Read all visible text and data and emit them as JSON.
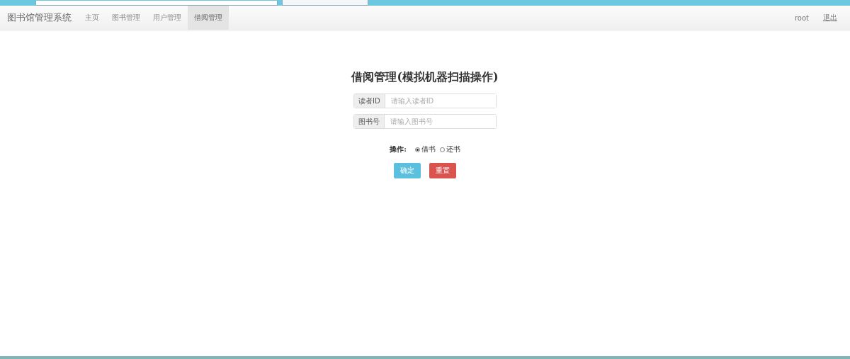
{
  "navbar": {
    "brand": "图书馆管理系统",
    "items": [
      {
        "label": "主页",
        "selected": false
      },
      {
        "label": "图书管理",
        "selected": false
      },
      {
        "label": "用户管理",
        "selected": false
      },
      {
        "label": "借阅管理",
        "selected": true
      }
    ],
    "user": "root",
    "logout": "退出"
  },
  "form": {
    "title": "借阅管理(模拟机器扫描操作)",
    "fields": [
      {
        "label": "读者ID",
        "placeholder": "请输入读者ID"
      },
      {
        "label": "图书号",
        "placeholder": "请输入图书号"
      }
    ],
    "operation": {
      "label": "操作:",
      "options": [
        {
          "label": "借书",
          "selected": true
        },
        {
          "label": "还书",
          "selected": false
        }
      ]
    },
    "buttons": [
      {
        "label": "确定",
        "kind": "primary"
      },
      {
        "label": "重置",
        "kind": "danger"
      }
    ]
  }
}
